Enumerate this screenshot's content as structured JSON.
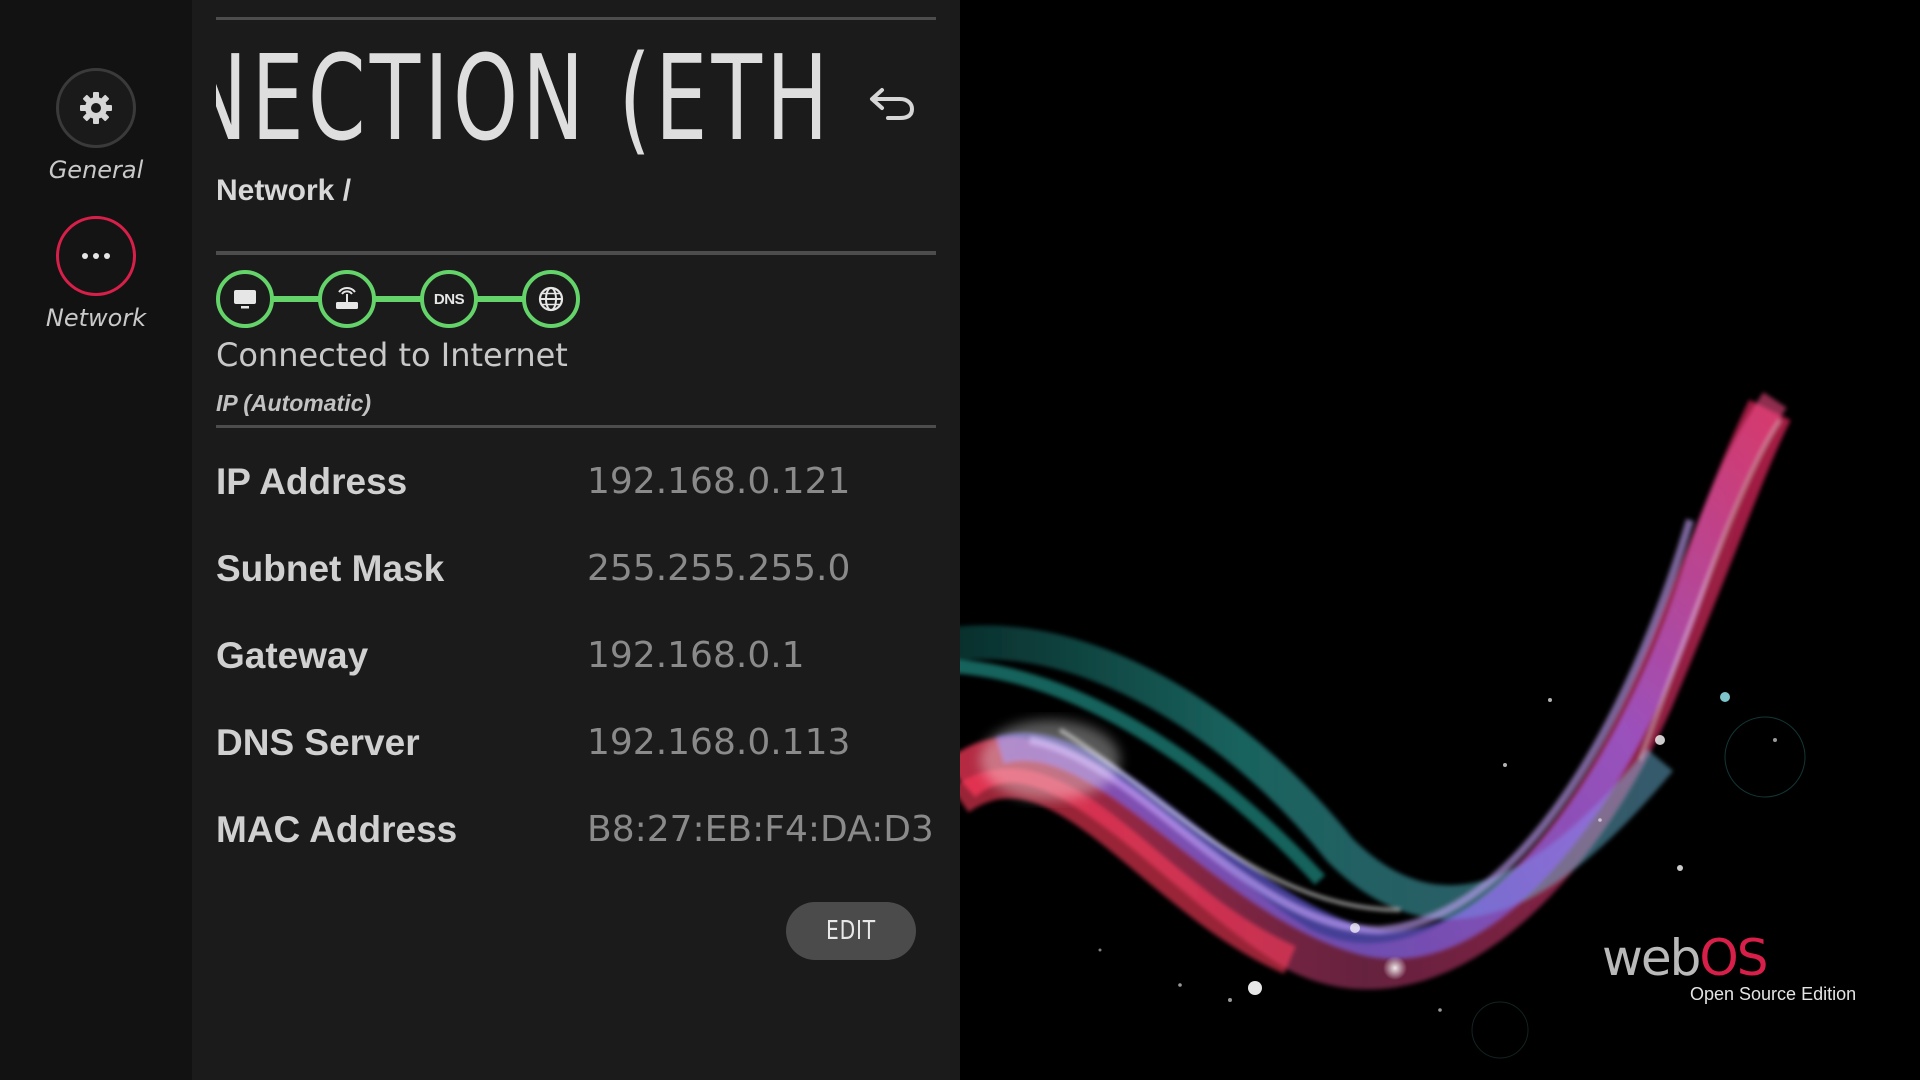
{
  "sidebar": {
    "items": [
      {
        "label": "General",
        "icon": "gear-icon",
        "selected": false
      },
      {
        "label": "Network",
        "icon": "more-dots-icon",
        "selected": true
      }
    ]
  },
  "header": {
    "title": "NNECTION (ETH",
    "breadcrumb": "Network /",
    "back_icon": "back-arrow-icon"
  },
  "connection": {
    "chain": [
      {
        "icon": "tv-icon",
        "ok": true
      },
      {
        "icon": "router-icon",
        "ok": true
      },
      {
        "icon": "dns-icon",
        "label": "DNS",
        "ok": true
      },
      {
        "icon": "globe-icon",
        "ok": true
      }
    ],
    "status": "Connected to Internet",
    "ip_mode": "IP (Automatic)"
  },
  "info": [
    {
      "label": "IP Address",
      "value": "192.168.0.121"
    },
    {
      "label": "Subnet Mask",
      "value": "255.255.255.0"
    },
    {
      "label": "Gateway",
      "value": "192.168.0.1"
    },
    {
      "label": "DNS Server",
      "value": "192.168.0.113"
    },
    {
      "label": "MAC Address",
      "value": "B8:27:EB:F4:DA:D3"
    }
  ],
  "actions": {
    "edit_label": "EDIT"
  },
  "branding": {
    "logo_web": "web",
    "logo_os": "OS",
    "edition": "Open Source Edition"
  },
  "colors": {
    "accent": "#d81f4a",
    "status_ok": "#64d36a",
    "panel_bg": "#1b1b1b",
    "rail_bg": "#121212"
  }
}
